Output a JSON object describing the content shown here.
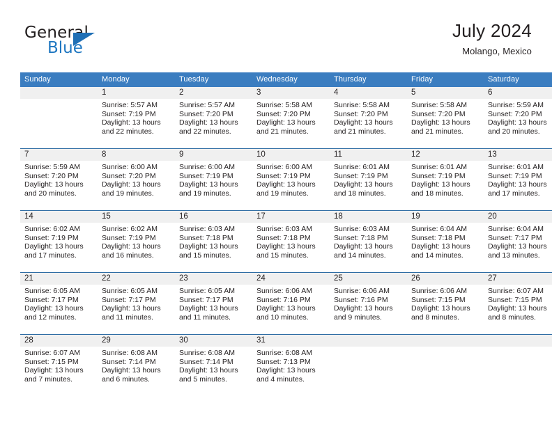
{
  "brand": {
    "name_part1": "General",
    "name_part2": "Blue",
    "triangle_color": "#1f6fb5",
    "blue_color": "#1f77c1"
  },
  "header": {
    "title": "July 2024",
    "subtitle": "Molango, Mexico"
  },
  "theme": {
    "header_bg": "#3b7dc0",
    "daynum_bg": "#f0f0f0",
    "grid_line": "#2e6da4",
    "text": "#231f20"
  },
  "weekdays": [
    "Sunday",
    "Monday",
    "Tuesday",
    "Wednesday",
    "Thursday",
    "Friday",
    "Saturday"
  ],
  "weeks": [
    [
      {
        "day": "",
        "empty": true,
        "sunrise": "",
        "sunset": "",
        "daylight1": "",
        "daylight2": ""
      },
      {
        "day": "1",
        "sunrise": "Sunrise: 5:57 AM",
        "sunset": "Sunset: 7:19 PM",
        "daylight1": "Daylight: 13 hours",
        "daylight2": "and 22 minutes."
      },
      {
        "day": "2",
        "sunrise": "Sunrise: 5:57 AM",
        "sunset": "Sunset: 7:20 PM",
        "daylight1": "Daylight: 13 hours",
        "daylight2": "and 22 minutes."
      },
      {
        "day": "3",
        "sunrise": "Sunrise: 5:58 AM",
        "sunset": "Sunset: 7:20 PM",
        "daylight1": "Daylight: 13 hours",
        "daylight2": "and 21 minutes."
      },
      {
        "day": "4",
        "sunrise": "Sunrise: 5:58 AM",
        "sunset": "Sunset: 7:20 PM",
        "daylight1": "Daylight: 13 hours",
        "daylight2": "and 21 minutes."
      },
      {
        "day": "5",
        "sunrise": "Sunrise: 5:58 AM",
        "sunset": "Sunset: 7:20 PM",
        "daylight1": "Daylight: 13 hours",
        "daylight2": "and 21 minutes."
      },
      {
        "day": "6",
        "sunrise": "Sunrise: 5:59 AM",
        "sunset": "Sunset: 7:20 PM",
        "daylight1": "Daylight: 13 hours",
        "daylight2": "and 20 minutes."
      }
    ],
    [
      {
        "day": "7",
        "sunrise": "Sunrise: 5:59 AM",
        "sunset": "Sunset: 7:20 PM",
        "daylight1": "Daylight: 13 hours",
        "daylight2": "and 20 minutes."
      },
      {
        "day": "8",
        "sunrise": "Sunrise: 6:00 AM",
        "sunset": "Sunset: 7:20 PM",
        "daylight1": "Daylight: 13 hours",
        "daylight2": "and 19 minutes."
      },
      {
        "day": "9",
        "sunrise": "Sunrise: 6:00 AM",
        "sunset": "Sunset: 7:19 PM",
        "daylight1": "Daylight: 13 hours",
        "daylight2": "and 19 minutes."
      },
      {
        "day": "10",
        "sunrise": "Sunrise: 6:00 AM",
        "sunset": "Sunset: 7:19 PM",
        "daylight1": "Daylight: 13 hours",
        "daylight2": "and 19 minutes."
      },
      {
        "day": "11",
        "sunrise": "Sunrise: 6:01 AM",
        "sunset": "Sunset: 7:19 PM",
        "daylight1": "Daylight: 13 hours",
        "daylight2": "and 18 minutes."
      },
      {
        "day": "12",
        "sunrise": "Sunrise: 6:01 AM",
        "sunset": "Sunset: 7:19 PM",
        "daylight1": "Daylight: 13 hours",
        "daylight2": "and 18 minutes."
      },
      {
        "day": "13",
        "sunrise": "Sunrise: 6:01 AM",
        "sunset": "Sunset: 7:19 PM",
        "daylight1": "Daylight: 13 hours",
        "daylight2": "and 17 minutes."
      }
    ],
    [
      {
        "day": "14",
        "sunrise": "Sunrise: 6:02 AM",
        "sunset": "Sunset: 7:19 PM",
        "daylight1": "Daylight: 13 hours",
        "daylight2": "and 17 minutes."
      },
      {
        "day": "15",
        "sunrise": "Sunrise: 6:02 AM",
        "sunset": "Sunset: 7:19 PM",
        "daylight1": "Daylight: 13 hours",
        "daylight2": "and 16 minutes."
      },
      {
        "day": "16",
        "sunrise": "Sunrise: 6:03 AM",
        "sunset": "Sunset: 7:18 PM",
        "daylight1": "Daylight: 13 hours",
        "daylight2": "and 15 minutes."
      },
      {
        "day": "17",
        "sunrise": "Sunrise: 6:03 AM",
        "sunset": "Sunset: 7:18 PM",
        "daylight1": "Daylight: 13 hours",
        "daylight2": "and 15 minutes."
      },
      {
        "day": "18",
        "sunrise": "Sunrise: 6:03 AM",
        "sunset": "Sunset: 7:18 PM",
        "daylight1": "Daylight: 13 hours",
        "daylight2": "and 14 minutes."
      },
      {
        "day": "19",
        "sunrise": "Sunrise: 6:04 AM",
        "sunset": "Sunset: 7:18 PM",
        "daylight1": "Daylight: 13 hours",
        "daylight2": "and 14 minutes."
      },
      {
        "day": "20",
        "sunrise": "Sunrise: 6:04 AM",
        "sunset": "Sunset: 7:17 PM",
        "daylight1": "Daylight: 13 hours",
        "daylight2": "and 13 minutes."
      }
    ],
    [
      {
        "day": "21",
        "sunrise": "Sunrise: 6:05 AM",
        "sunset": "Sunset: 7:17 PM",
        "daylight1": "Daylight: 13 hours",
        "daylight2": "and 12 minutes."
      },
      {
        "day": "22",
        "sunrise": "Sunrise: 6:05 AM",
        "sunset": "Sunset: 7:17 PM",
        "daylight1": "Daylight: 13 hours",
        "daylight2": "and 11 minutes."
      },
      {
        "day": "23",
        "sunrise": "Sunrise: 6:05 AM",
        "sunset": "Sunset: 7:17 PM",
        "daylight1": "Daylight: 13 hours",
        "daylight2": "and 11 minutes."
      },
      {
        "day": "24",
        "sunrise": "Sunrise: 6:06 AM",
        "sunset": "Sunset: 7:16 PM",
        "daylight1": "Daylight: 13 hours",
        "daylight2": "and 10 minutes."
      },
      {
        "day": "25",
        "sunrise": "Sunrise: 6:06 AM",
        "sunset": "Sunset: 7:16 PM",
        "daylight1": "Daylight: 13 hours",
        "daylight2": "and 9 minutes."
      },
      {
        "day": "26",
        "sunrise": "Sunrise: 6:06 AM",
        "sunset": "Sunset: 7:15 PM",
        "daylight1": "Daylight: 13 hours",
        "daylight2": "and 8 minutes."
      },
      {
        "day": "27",
        "sunrise": "Sunrise: 6:07 AM",
        "sunset": "Sunset: 7:15 PM",
        "daylight1": "Daylight: 13 hours",
        "daylight2": "and 8 minutes."
      }
    ],
    [
      {
        "day": "28",
        "sunrise": "Sunrise: 6:07 AM",
        "sunset": "Sunset: 7:15 PM",
        "daylight1": "Daylight: 13 hours",
        "daylight2": "and 7 minutes."
      },
      {
        "day": "29",
        "sunrise": "Sunrise: 6:08 AM",
        "sunset": "Sunset: 7:14 PM",
        "daylight1": "Daylight: 13 hours",
        "daylight2": "and 6 minutes."
      },
      {
        "day": "30",
        "sunrise": "Sunrise: 6:08 AM",
        "sunset": "Sunset: 7:14 PM",
        "daylight1": "Daylight: 13 hours",
        "daylight2": "and 5 minutes."
      },
      {
        "day": "31",
        "sunrise": "Sunrise: 6:08 AM",
        "sunset": "Sunset: 7:13 PM",
        "daylight1": "Daylight: 13 hours",
        "daylight2": "and 4 minutes."
      },
      {
        "day": "",
        "empty": true,
        "sunrise": "",
        "sunset": "",
        "daylight1": "",
        "daylight2": ""
      },
      {
        "day": "",
        "empty": true,
        "sunrise": "",
        "sunset": "",
        "daylight1": "",
        "daylight2": ""
      },
      {
        "day": "",
        "empty": true,
        "sunrise": "",
        "sunset": "",
        "daylight1": "",
        "daylight2": ""
      }
    ]
  ]
}
